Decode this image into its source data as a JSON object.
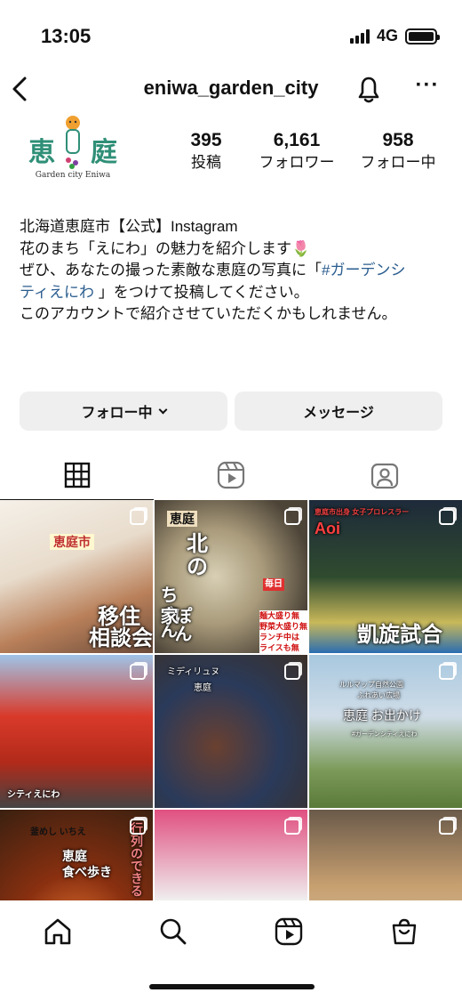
{
  "status_bar": {
    "time": "13:05",
    "network": "4G"
  },
  "header": {
    "username": "eniwa_garden_city"
  },
  "profile": {
    "logo_kanji_left": "恵",
    "logo_kanji_right": "庭",
    "logo_subtitle": "Garden city Eniwa",
    "stats": [
      {
        "value": "395",
        "label": "投稿"
      },
      {
        "value": "6,161",
        "label": "フォロワー"
      },
      {
        "value": "958",
        "label": "フォロー中"
      }
    ],
    "bio": {
      "line1": "北海道恵庭市【公式】Instagram",
      "line2": "花のまち「えにわ」の魅力を紹介します",
      "line2_emoji": "🌷",
      "line3a": "ぜひ、あなたの撮った素敵な恵庭の写真に「",
      "line3_tag1": "#ガーデンシ",
      "line4_tag2": "ティえにわ",
      "line4b": " 」をつけて投稿してください。",
      "line5": "このアカウントで紹介させていただくかもしれません。"
    }
  },
  "actions": {
    "follow_label": "フォロー中",
    "message_label": "メッセージ"
  },
  "grid": {
    "posts": [
      {
        "caption_top": "恵庭市",
        "caption_main_1": "移住",
        "caption_main_2": "相談会"
      },
      {
        "caption_top": "恵庭",
        "caption_main_1": "北",
        "caption_main_2": "の",
        "caption_main_3": "ちゃん",
        "caption_main_4": "ぽん家",
        "badge": "毎日",
        "note_1": "麺大盛り無料！",
        "note_2": "野菜大盛り無料！",
        "note_3": "ランチ中は",
        "note_4": "ライスも無料！"
      },
      {
        "caption_top": "恵庭市出身 女子プロレスラー",
        "caption_name": "Aoi",
        "caption_main": "凱旋試合"
      },
      {
        "caption_bottom": "シティえにわ"
      },
      {
        "caption_top": "ミディリュヌ",
        "caption_sub": "恵庭"
      },
      {
        "caption_top": "ルルマップ自然公園",
        "caption_top2": "ふれあい広場",
        "caption_main": "恵庭 お出かけ",
        "caption_sub": "#ガーデンシティえにわ"
      },
      {
        "caption_top": "釜めし いちえ",
        "caption_main_1": "恵庭",
        "caption_main_2": "食べ歩き",
        "caption_side": "行列のできる"
      },
      {},
      {}
    ]
  },
  "colors": {
    "hashtag": "#2a5d8f",
    "button_bg": "#efefef",
    "logo_green": "#2f8f77"
  }
}
